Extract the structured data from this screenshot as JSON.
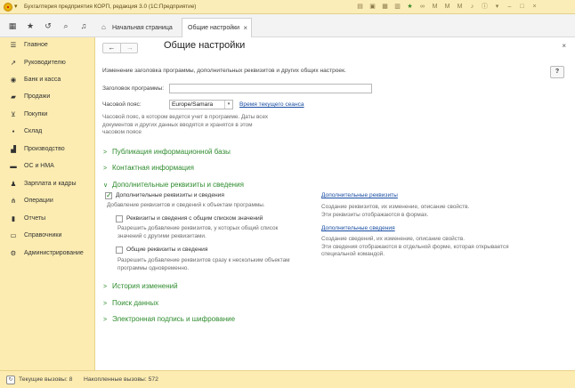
{
  "window": {
    "title": "Бухгалтерия предприятия КОРП, редакция 3.0  (1С:Предприятие)"
  },
  "tabs": {
    "home": "Начальная страница",
    "active": "Общие настройки"
  },
  "sidebar": {
    "items": [
      {
        "label": "Главное",
        "icon": "menu-icon"
      },
      {
        "label": "Руководителю",
        "icon": "chart-icon"
      },
      {
        "label": "Банк и касса",
        "icon": "bank-icon"
      },
      {
        "label": "Продажи",
        "icon": "sales-icon"
      },
      {
        "label": "Покупки",
        "icon": "cart-icon"
      },
      {
        "label": "Склад",
        "icon": "warehouse-icon"
      },
      {
        "label": "Производство",
        "icon": "factory-icon"
      },
      {
        "label": "ОС и НМА",
        "icon": "truck-icon"
      },
      {
        "label": "Зарплата и кадры",
        "icon": "people-icon"
      },
      {
        "label": "Операции",
        "icon": "operations-icon"
      },
      {
        "label": "Отчеты",
        "icon": "reports-icon"
      },
      {
        "label": "Справочники",
        "icon": "book-icon"
      },
      {
        "label": "Администрирование",
        "icon": "gear-icon"
      }
    ]
  },
  "main": {
    "title": "Общие настройки",
    "description": "Изменение заголовка программы, дополнительных реквизитов и других общих настроек.",
    "help": "?",
    "program_title_label": "Заголовок программы:",
    "program_title_value": "",
    "timezone_label": "Часовой пояс:",
    "timezone_value": "Europe/Samara",
    "session_time_link": "Время текущего сеанса",
    "timezone_hint": [
      "Часовой пояс, в котором ведется учет в программе. Даты всех",
      "документов и других данных вводятся и хранятся в этом",
      "часовом поясе"
    ],
    "sections": {
      "infobase": "Публикация информационной базы",
      "contacts": "Контактная информация",
      "additional": "Дополнительные реквизиты и сведения",
      "history": "История изменений",
      "search": "Поиск данных",
      "signature": "Электронная подпись и шифрование"
    },
    "additional": {
      "main_check_label": "Дополнительные реквизиты и сведения",
      "main_check_hint": "Добавление реквизитов и сведений к объектам программы.",
      "list_check_label": "Реквизиты и сведения с общим списком значений",
      "list_check_hint": [
        "Разрешить добавление реквизитов, у которых общий список",
        "значений с другими реквизитами."
      ],
      "common_check_label": "Общие реквизиты и сведения",
      "common_check_hint": [
        "Разрешить добавление реквизитов сразу к нескольким объектам",
        "программы одновременно."
      ],
      "attr_link": "Дополнительные реквизиты",
      "attr_hint": [
        "Создание реквизитов, их изменение, описание свойств.",
        "Эти реквизиты отображаются в формах."
      ],
      "info_link": "Дополнительные сведения",
      "info_hint": [
        "Создание сведений, их изменение, описание свойств.",
        "Эти сведения отображаются в отдельной форме, которая открывается",
        "специальной командой."
      ]
    }
  },
  "status": {
    "current_calls": "Текущие вызовы: 8",
    "accumulated_calls": "Накопленные вызовы: 572"
  }
}
